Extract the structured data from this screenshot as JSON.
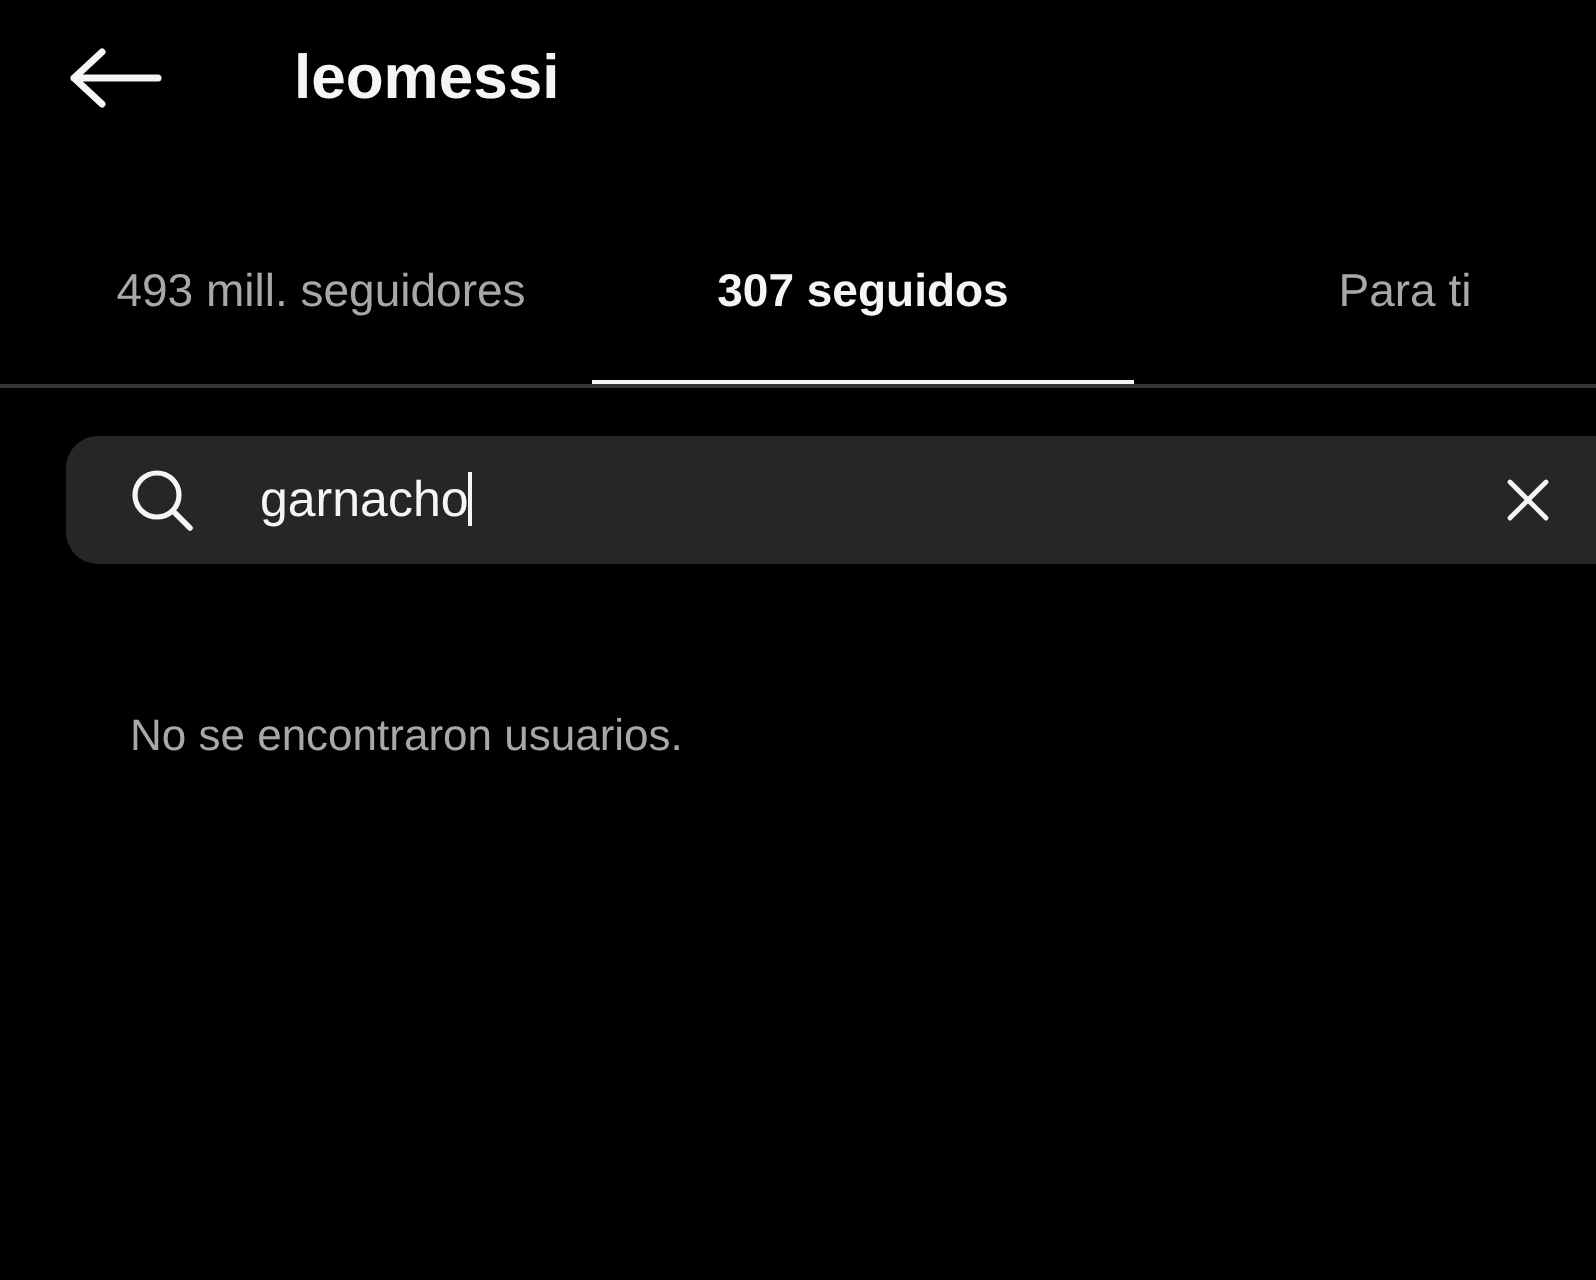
{
  "header": {
    "title": "leomessi"
  },
  "tabs": [
    {
      "label": "493 mill. seguidores",
      "selected": false
    },
    {
      "label": "307 seguidos",
      "selected": true
    },
    {
      "label": "Para ti",
      "selected": false
    }
  ],
  "search": {
    "value": "garnacho",
    "focused": true
  },
  "empty_message": "No se encontraron usuarios."
}
